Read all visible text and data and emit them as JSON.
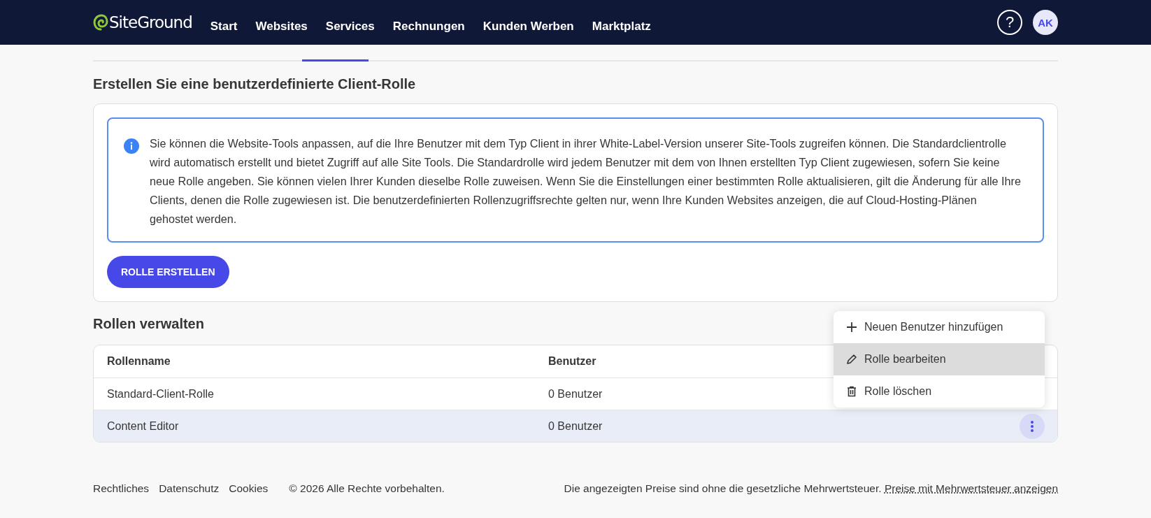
{
  "header": {
    "logo": "SiteGround",
    "nav": [
      {
        "label": "Start",
        "selected": false
      },
      {
        "label": "Websites",
        "selected": false
      },
      {
        "label": "Services",
        "selected": false
      },
      {
        "label": "Rechnungen",
        "selected": false
      },
      {
        "label": "Kunden Werben",
        "selected": false
      },
      {
        "label": "Marktplatz",
        "selected": false
      }
    ],
    "help": "?",
    "avatar": "AK"
  },
  "create_section": {
    "title": "Erstellen Sie eine benutzerdefinierte Client-Rolle",
    "info": "Sie können die Website-Tools anpassen, auf die Ihre Benutzer mit dem Typ Client in ihrer White-Label-Version unserer Site-Tools zugreifen können. Die Standardclientrolle wird automatisch erstellt und bietet Zugriff auf alle Site Tools. Die Standardrolle wird jedem Benutzer mit dem von Ihnen erstellten Typ Client zugewiesen, sofern Sie keine neue Rolle angeben. Sie können vielen Ihrer Kunden dieselbe Rolle zuweisen. Wenn Sie die Einstellungen einer bestimmten Rolle aktualisieren, gilt die Änderung für alle Ihre Clients, denen die Rolle zugewiesen ist. Die benutzerdefinierten Rollenzugriffsrechte gelten nur, wenn Ihre Kunden Websites anzeigen, die auf Cloud-Hosting-Plänen gehostet werden.",
    "button": "ROLLE ERSTELLEN"
  },
  "roles_section": {
    "title": "Rollen verwalten",
    "table": {
      "columns": [
        "Rollenname",
        "Benutzer"
      ],
      "rows": [
        {
          "cells": [
            "Standard-Client-Rolle",
            "0 Benutzer"
          ],
          "selected": false
        },
        {
          "cells": [
            "Content Editor",
            "0 Benutzer"
          ],
          "selected": true
        }
      ]
    },
    "menu": [
      {
        "kind": "add",
        "label": "Neuen Benutzer hinzufügen",
        "selected": false
      },
      {
        "kind": "edit",
        "label": "Rolle bearbeiten",
        "selected": true
      },
      {
        "kind": "delete",
        "label": "Rolle löschen",
        "selected": false
      }
    ]
  },
  "footer": {
    "links": [
      "Rechtliches",
      "Datenschutz",
      "Cookies"
    ],
    "copyright": "© 2026 Alle Rechte vorbehalten.",
    "note": "Die angezeigten Preise sind ohne die gesetzliche Mehrwertsteuer.",
    "note_link": "Preise mit Mehrwertsteuer anzeigen"
  }
}
